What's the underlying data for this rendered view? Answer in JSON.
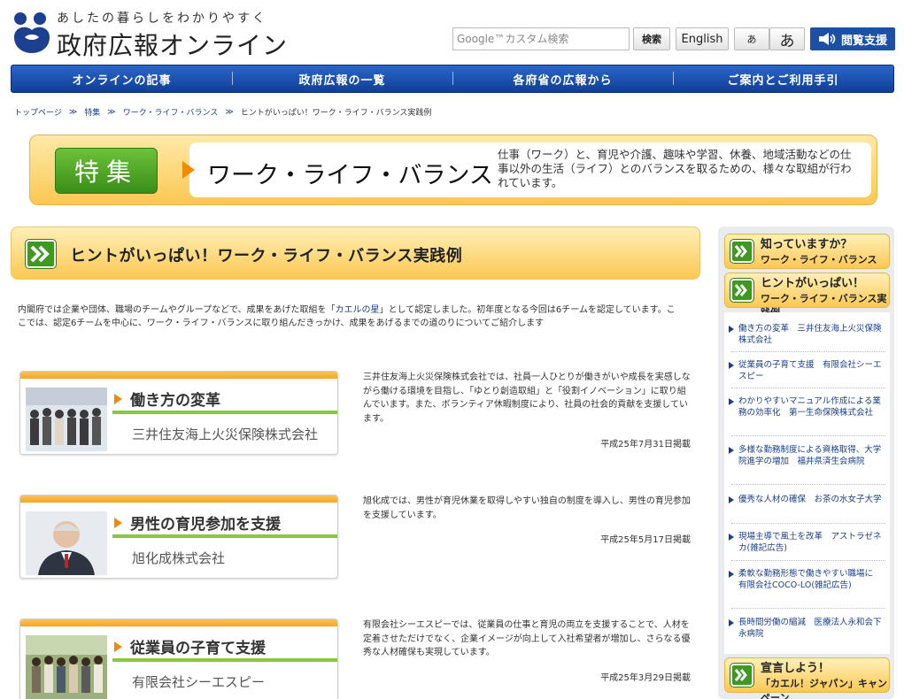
{
  "header": {
    "tagline": "あしたの暮らしをわかりやすく",
    "site_title": "政府広報オンライン",
    "search_placeholder": "Google™カスタム検索",
    "search_button": "検索",
    "english_button": "English",
    "font_small": "あ",
    "font_large": "あ",
    "reader_button": "閲覧支援"
  },
  "nav": {
    "items": [
      "オンラインの記事",
      "政府広報の一覧",
      "各府省の広報から",
      "ご案内とご利用手引"
    ]
  },
  "breadcrumb": {
    "items": [
      "トップページ",
      "特集",
      "ワーク・ライフ・バランス",
      "ヒントがいっぱい！ワーク・ライフ・バランス実践例"
    ]
  },
  "feature": {
    "badge": "特集",
    "title": "ワーク・ライフ・バランス",
    "description": "仕事（ワーク）と、育児や介護、趣味や学習、休養、地域活動などの仕事以外の生活（ライフ）とのバランスを取るための、様々な取組が行われています。"
  },
  "main": {
    "heading": "ヒントがいっぱい！ワーク・ライフ・バランス実践例",
    "intro_before": "内閣府では企業や団体、職場のチームやグループなどで、成果をあげた取組を",
    "intro_highlight": "「カエルの星」",
    "intro_after": "として認定しました。初年度となる今回は6チームを認定しています。ここでは、認定6チームを中心に、ワーク・ライフ・バランスに取り組んだきっかけ、成果をあげるまでの道のりについてご紹介します"
  },
  "cards": [
    {
      "title": "働き方の変革",
      "company": "三井住友海上火災保険株式会社",
      "description": "三井住友海上火災保険株式会社では、社員一人ひとりが働きがいや成長を実感しながら働ける環境を目指し、「ゆとり創造取組」と「役割イノベーション」に取り組んでいます。また、ボランティア休暇制度により、社員の社会的貢献を支援しています。",
      "date": "平成25年7月31日掲載"
    },
    {
      "title": "男性の育児参加を支援",
      "company": "旭化成株式会社",
      "description": "旭化成では、男性が育児休業を取得しやすい独自の制度を導入し、男性の育児参加を支援しています。",
      "date": "平成25年5月17日掲載"
    },
    {
      "title": "従業員の子育て支援",
      "company": "有限会社シーエスピー",
      "description": "有限会社シーエスピーでは、従業員の仕事と育児の両立を支援することで、人材を定着させただけでなく、企業イメージが向上して入社希望者が増加し、さらなる優秀な人材確保も実現しています。",
      "date": "平成25年3月29日掲載"
    }
  ],
  "sidebar": {
    "banner1": {
      "title": "知っていますか？",
      "sub": "ワーク・ライフ・バランス"
    },
    "banner2": {
      "title": "ヒントがいっぱい！",
      "sub": "ワーク・ライフ・バランス実践例"
    },
    "links": [
      "働き方の変革　三井住友海上火災保険株式会社",
      "従業員の子育て支援　有限会社シーエスピー",
      "わかりやすいマニュアル作成による業務の効率化　第一生命保険株式会社",
      "多様な勤務制度による資格取得、大学院進学の増加　福井県済生会病院",
      "優秀な人材の確保　お茶の水女子大学",
      "現場主導で風土を改革　アストラゼネカ(雑記広告)",
      "柔軟な勤務形態で働きやすい職場に　有限会社COCO-LO(雑記広告)",
      "長時間労働の縮減　医療法人永和会下永病院"
    ],
    "banner3": {
      "title": "宣言しよう！",
      "sub": "「カエル！ジャパン」キャンペーン"
    }
  },
  "colors": {
    "nav_blue": "#1a4ea8",
    "accent_orange": "#f08a00",
    "accent_green": "#8cc63f",
    "banner_yellow": "#fbc853",
    "link_blue": "#1a3f8c"
  }
}
